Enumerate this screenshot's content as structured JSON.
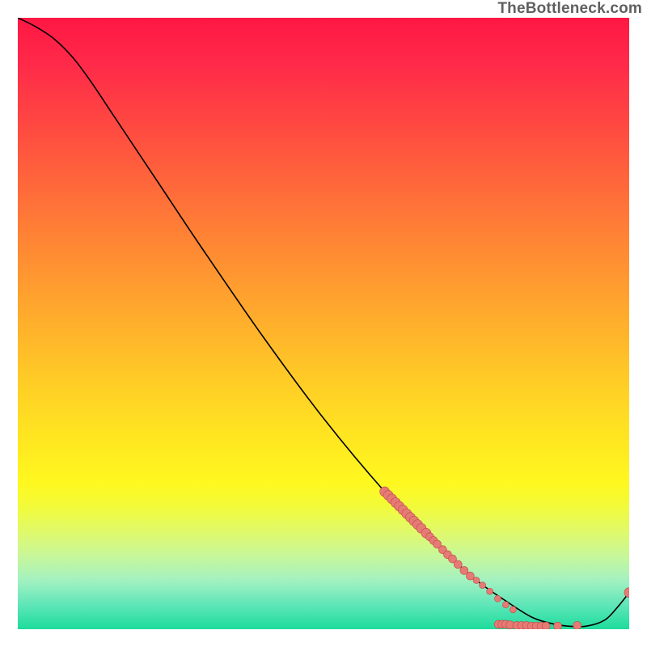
{
  "watermark": "TheBottleneck.com",
  "chart_data": {
    "type": "line",
    "title": "",
    "xlabel": "",
    "ylabel": "",
    "xlim": [
      0,
      1
    ],
    "ylim": [
      0,
      1
    ],
    "series": [
      {
        "name": "curve",
        "x": [
          0.0,
          0.03,
          0.06,
          0.09,
          0.12,
          0.16,
          0.23,
          0.3,
          0.4,
          0.5,
          0.6,
          0.66,
          0.7,
          0.75,
          0.8,
          0.84,
          0.87,
          0.9,
          0.93,
          0.96,
          0.98,
          1.0
        ],
        "y": [
          1.0,
          0.985,
          0.965,
          0.935,
          0.895,
          0.835,
          0.73,
          0.625,
          0.48,
          0.345,
          0.225,
          0.165,
          0.125,
          0.08,
          0.045,
          0.02,
          0.01,
          0.005,
          0.005,
          0.015,
          0.035,
          0.06
        ]
      }
    ],
    "points": {
      "name": "markers",
      "color": "#e67a75",
      "data": [
        {
          "x": 0.6,
          "y": 0.225,
          "r": 6
        },
        {
          "x": 0.606,
          "y": 0.219,
          "r": 6
        },
        {
          "x": 0.612,
          "y": 0.213,
          "r": 6
        },
        {
          "x": 0.618,
          "y": 0.207,
          "r": 6
        },
        {
          "x": 0.624,
          "y": 0.201,
          "r": 6
        },
        {
          "x": 0.63,
          "y": 0.195,
          "r": 6
        },
        {
          "x": 0.636,
          "y": 0.189,
          "r": 6
        },
        {
          "x": 0.642,
          "y": 0.183,
          "r": 6
        },
        {
          "x": 0.648,
          "y": 0.177,
          "r": 6
        },
        {
          "x": 0.654,
          "y": 0.171,
          "r": 6
        },
        {
          "x": 0.66,
          "y": 0.165,
          "r": 6
        },
        {
          "x": 0.668,
          "y": 0.157,
          "r": 6
        },
        {
          "x": 0.674,
          "y": 0.151,
          "r": 5
        },
        {
          "x": 0.68,
          "y": 0.145,
          "r": 5
        },
        {
          "x": 0.686,
          "y": 0.139,
          "r": 5
        },
        {
          "x": 0.695,
          "y": 0.13,
          "r": 5
        },
        {
          "x": 0.703,
          "y": 0.122,
          "r": 5
        },
        {
          "x": 0.711,
          "y": 0.115,
          "r": 5
        },
        {
          "x": 0.72,
          "y": 0.106,
          "r": 5
        },
        {
          "x": 0.73,
          "y": 0.096,
          "r": 5
        },
        {
          "x": 0.74,
          "y": 0.087,
          "r": 5
        },
        {
          "x": 0.75,
          "y": 0.08,
          "r": 4
        },
        {
          "x": 0.76,
          "y": 0.072,
          "r": 4
        },
        {
          "x": 0.772,
          "y": 0.062,
          "r": 4
        },
        {
          "x": 0.785,
          "y": 0.05,
          "r": 4
        },
        {
          "x": 0.798,
          "y": 0.04,
          "r": 4
        },
        {
          "x": 0.81,
          "y": 0.032,
          "r": 4
        },
        {
          "x": 0.786,
          "y": 0.008,
          "r": 5
        },
        {
          "x": 0.792,
          "y": 0.008,
          "r": 5
        },
        {
          "x": 0.798,
          "y": 0.008,
          "r": 5
        },
        {
          "x": 0.805,
          "y": 0.007,
          "r": 5
        },
        {
          "x": 0.816,
          "y": 0.006,
          "r": 5
        },
        {
          "x": 0.824,
          "y": 0.006,
          "r": 5
        },
        {
          "x": 0.832,
          "y": 0.006,
          "r": 5
        },
        {
          "x": 0.84,
          "y": 0.005,
          "r": 5
        },
        {
          "x": 0.848,
          "y": 0.005,
          "r": 5
        },
        {
          "x": 0.856,
          "y": 0.005,
          "r": 5
        },
        {
          "x": 0.864,
          "y": 0.005,
          "r": 5
        },
        {
          "x": 0.883,
          "y": 0.005,
          "r": 5
        },
        {
          "x": 0.915,
          "y": 0.006,
          "r": 5
        },
        {
          "x": 1.0,
          "y": 0.06,
          "r": 6
        }
      ]
    }
  }
}
